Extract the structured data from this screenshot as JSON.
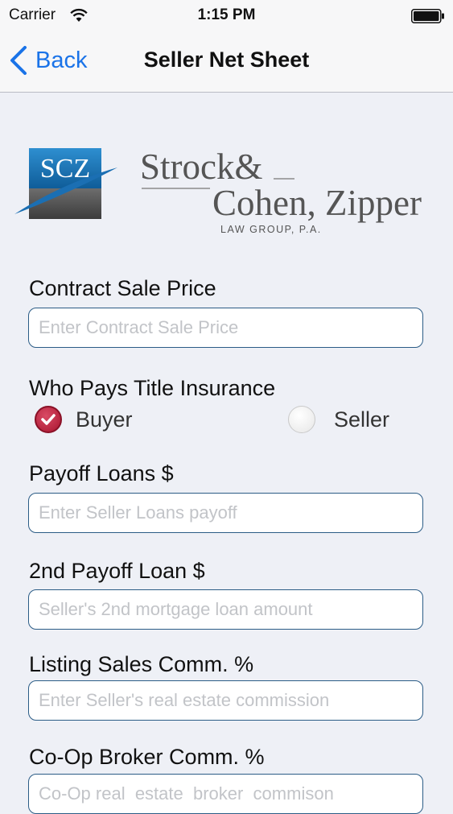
{
  "status_bar": {
    "carrier": "Carrier",
    "time": "1:15 PM"
  },
  "nav": {
    "back_label": "Back",
    "title": "Seller Net Sheet"
  },
  "logo": {
    "monogram": "SCZ",
    "line1": "Strock&",
    "line2": "Cohen, Zipper",
    "tagline": "LAW GROUP, P.A."
  },
  "form": {
    "contract_sale_price": {
      "label": "Contract Sale Price",
      "placeholder": "Enter Contract Sale Price",
      "value": ""
    },
    "title_insurance": {
      "label": "Who Pays Title Insurance",
      "options": [
        "Buyer",
        "Seller"
      ],
      "selected": "Buyer"
    },
    "payoff_loans": {
      "label": "Payoff Loans $",
      "placeholder": "Enter Seller Loans payoff",
      "value": ""
    },
    "second_payoff": {
      "label": "2nd Payoff Loan $",
      "placeholder": "Seller's 2nd mortgage loan amount",
      "value": ""
    },
    "listing_comm": {
      "label": "Listing Sales Comm. %",
      "placeholder": "Enter Seller's real estate commission",
      "value": ""
    },
    "coop_comm": {
      "label": "Co-Op Broker Comm. %",
      "placeholder": "Co-Op real  estate  broker  commison",
      "value": ""
    }
  },
  "colors": {
    "accent": "#1a73e8",
    "field_border": "#2b5c86",
    "radio_selected": "#a8142f",
    "background": "#eef0f6"
  }
}
